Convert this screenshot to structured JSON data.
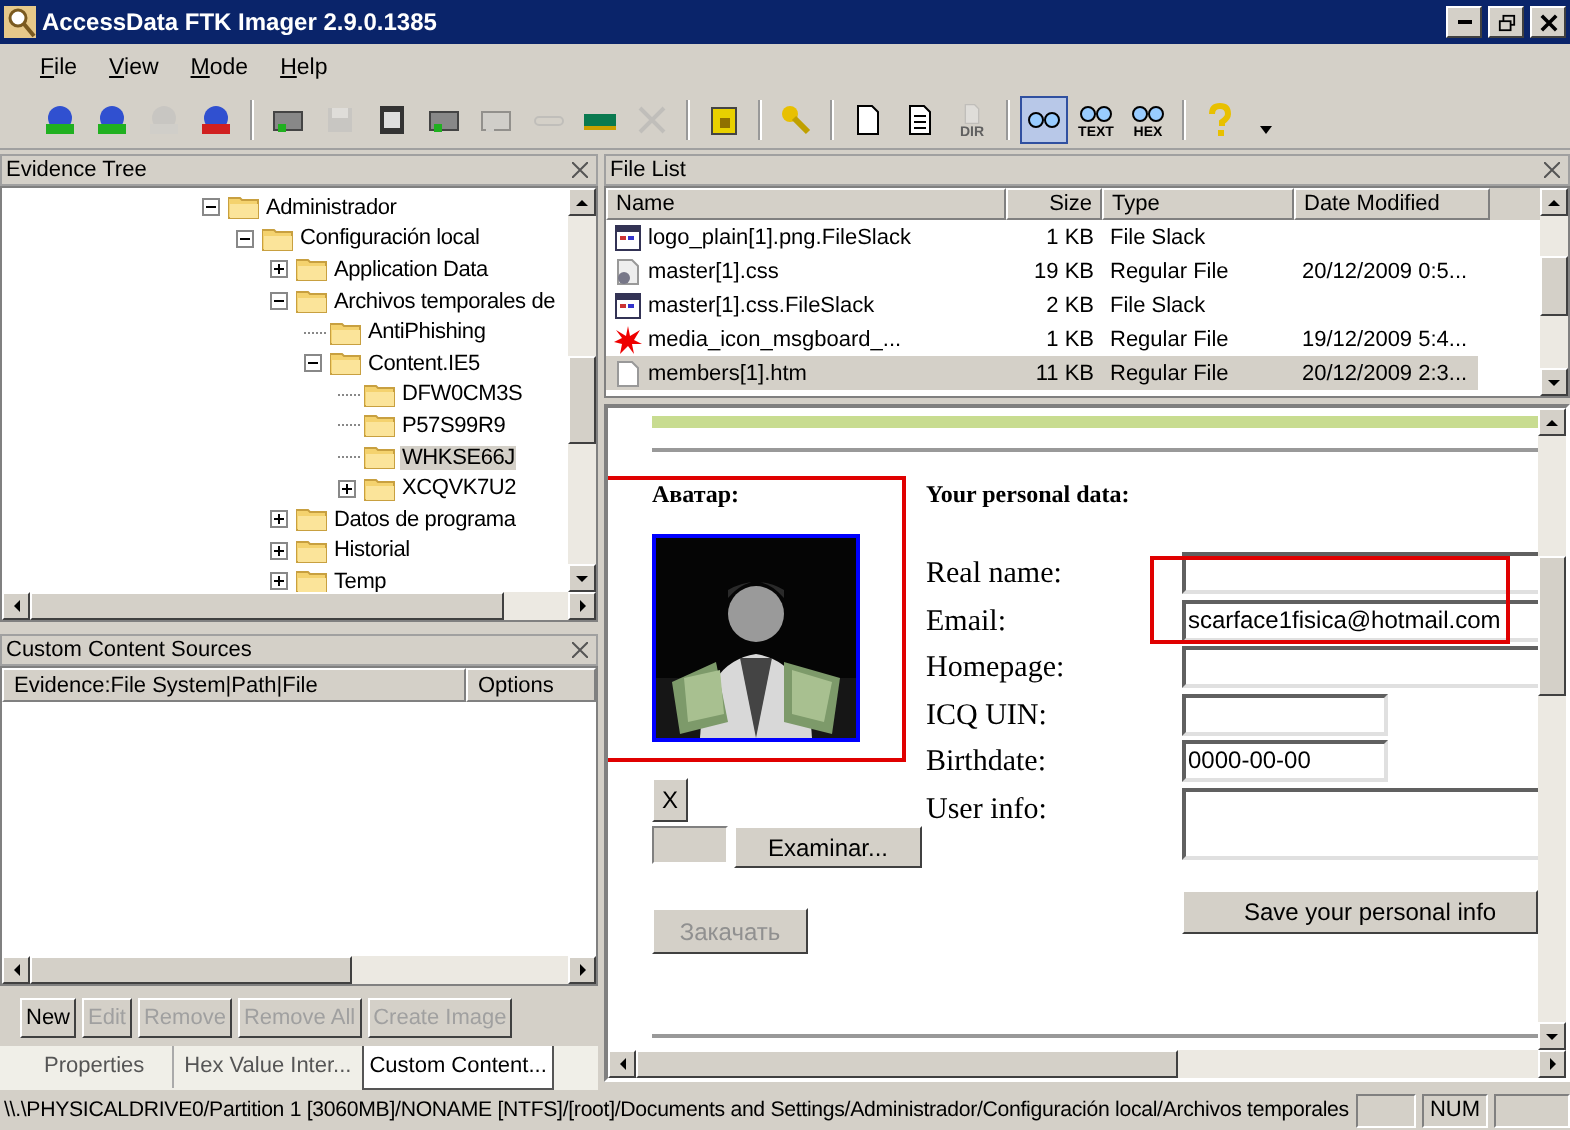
{
  "window": {
    "title": "AccessData FTK Imager 2.9.0.1385"
  },
  "menu": [
    "File",
    "View",
    "Mode",
    "Help"
  ],
  "toolbar": [
    {
      "kind": "evidence",
      "disabled": false,
      "pressed": false
    },
    {
      "kind": "evidence",
      "disabled": false,
      "pressed": false
    },
    {
      "kind": "evidence",
      "disabled": true,
      "pressed": false
    },
    {
      "kind": "remove",
      "disabled": false,
      "pressed": false
    },
    {
      "kind": "sep"
    },
    {
      "kind": "drive",
      "disabled": false,
      "pressed": false
    },
    {
      "kind": "disk",
      "disabled": true,
      "pressed": false
    },
    {
      "kind": "film",
      "disabled": false,
      "pressed": false
    },
    {
      "kind": "drive",
      "disabled": false,
      "pressed": false
    },
    {
      "kind": "drive",
      "disabled": true,
      "pressed": false
    },
    {
      "kind": "link",
      "disabled": true,
      "pressed": false
    },
    {
      "kind": "chip",
      "disabled": false,
      "pressed": false
    },
    {
      "kind": "tools",
      "disabled": true,
      "pressed": false
    },
    {
      "kind": "sep"
    },
    {
      "kind": "box",
      "disabled": false,
      "pressed": false
    },
    {
      "kind": "sep"
    },
    {
      "kind": "key",
      "disabled": false,
      "pressed": false
    },
    {
      "kind": "sep"
    },
    {
      "kind": "page",
      "disabled": false,
      "pressed": false
    },
    {
      "kind": "lines",
      "disabled": false,
      "pressed": false
    },
    {
      "kind": "page",
      "disabled": true,
      "pressed": false,
      "label": "DIR"
    },
    {
      "kind": "sep"
    },
    {
      "kind": "glasses",
      "disabled": false,
      "pressed": true
    },
    {
      "kind": "glasses",
      "disabled": false,
      "pressed": false,
      "label": "TEXT"
    },
    {
      "kind": "glasses",
      "disabled": false,
      "pressed": false,
      "label": "HEX"
    },
    {
      "kind": "sep"
    },
    {
      "kind": "help",
      "disabled": false,
      "pressed": false
    }
  ],
  "evidence_tree": {
    "title": "Evidence Tree",
    "items": [
      {
        "label": "Administrador",
        "expanded": true,
        "selected": false,
        "children": [
          {
            "label": "Configuración local",
            "expanded": true,
            "selected": false,
            "children": [
              {
                "label": "Application Data",
                "expanded": false,
                "selected": false
              },
              {
                "label": "Archivos temporales de",
                "expanded": true,
                "selected": false,
                "children": [
                  {
                    "label": "AntiPhishing",
                    "selected": false
                  },
                  {
                    "label": "Content.IE5",
                    "expanded": true,
                    "selected": false,
                    "children": [
                      {
                        "label": "DFW0CM3S",
                        "selected": false
                      },
                      {
                        "label": "P57S99R9",
                        "selected": false
                      },
                      {
                        "label": "WHKSE66J",
                        "selected": true
                      },
                      {
                        "label": "XCQVK7U2",
                        "expanded": false,
                        "selected": false
                      }
                    ]
                  }
                ]
              },
              {
                "label": "Datos de programa",
                "expanded": false,
                "selected": false
              },
              {
                "label": "Historial",
                "expanded": false,
                "selected": false
              },
              {
                "label": "Temp",
                "expanded": false,
                "selected": false
              }
            ]
          }
        ]
      }
    ]
  },
  "custom_content": {
    "title": "Custom Content Sources",
    "columns": [
      "Evidence:File System|Path|File",
      "Options"
    ],
    "buttons": [
      {
        "label": "New",
        "disabled": false
      },
      {
        "label": "Edit",
        "disabled": true
      },
      {
        "label": "Remove",
        "disabled": true
      },
      {
        "label": "Remove All",
        "disabled": true
      },
      {
        "label": "Create Image",
        "disabled": true
      }
    ]
  },
  "bottom_tabs": [
    {
      "label": "Properties",
      "selected": false
    },
    {
      "label": "Hex Value Inter...",
      "selected": false
    },
    {
      "label": "Custom Content...",
      "selected": true
    }
  ],
  "file_list": {
    "title": "File List",
    "columns": [
      "Name",
      "Size",
      "Type",
      "Date Modified"
    ],
    "rows": [
      {
        "kind": "slack",
        "name": "logo_plain[1].png.FileSlack",
        "size": "1 KB",
        "type": "File Slack",
        "selected": false
      },
      {
        "kind": "css",
        "name": "master[1].css",
        "size": "19 KB",
        "type": "Regular File",
        "date": "20/12/2009 0:5...",
        "selected": false
      },
      {
        "kind": "slack",
        "name": "master[1].css.FileSlack",
        "size": "2 KB",
        "type": "File Slack",
        "selected": false
      },
      {
        "kind": "media",
        "name": "media_icon_msgboard_...",
        "size": "1 KB",
        "type": "Regular File",
        "date": "19/12/2009 5:4...",
        "selected": false
      },
      {
        "kind": "htm",
        "name": "members[1].htm",
        "size": "11 KB",
        "type": "Regular File",
        "date": "20/12/2009 2:3...",
        "selected": true
      }
    ]
  },
  "preview": {
    "avatar_heading": "Аватар:",
    "data_heading": "Your personal data:",
    "fields": [
      {
        "label": "Real name:",
        "kind": "wide"
      },
      {
        "label": "Email:",
        "kind": "wide",
        "value": "scarface1fisica@hotmail.com"
      },
      {
        "label": "Homepage:",
        "kind": "wide"
      },
      {
        "label": "ICQ UIN:",
        "kind": "short"
      },
      {
        "label": "Birthdate:",
        "kind": "short",
        "value": "0000-00-00"
      },
      {
        "label": "User info:",
        "kind": "area"
      }
    ],
    "delete_button": "X",
    "browse_button": "Examinar...",
    "upload_button": {
      "label": "Закачать",
      "disabled": true
    },
    "save_button": "Save your personal info"
  },
  "status_bar": {
    "path": "\\\\.\\PHYSICALDRIVE0/Partition 1 [3060MB]/NONAME [NTFS]/[root]/Documents and Settings/Administrador/Configuración local/Archivos temporales",
    "num": "NUM"
  }
}
